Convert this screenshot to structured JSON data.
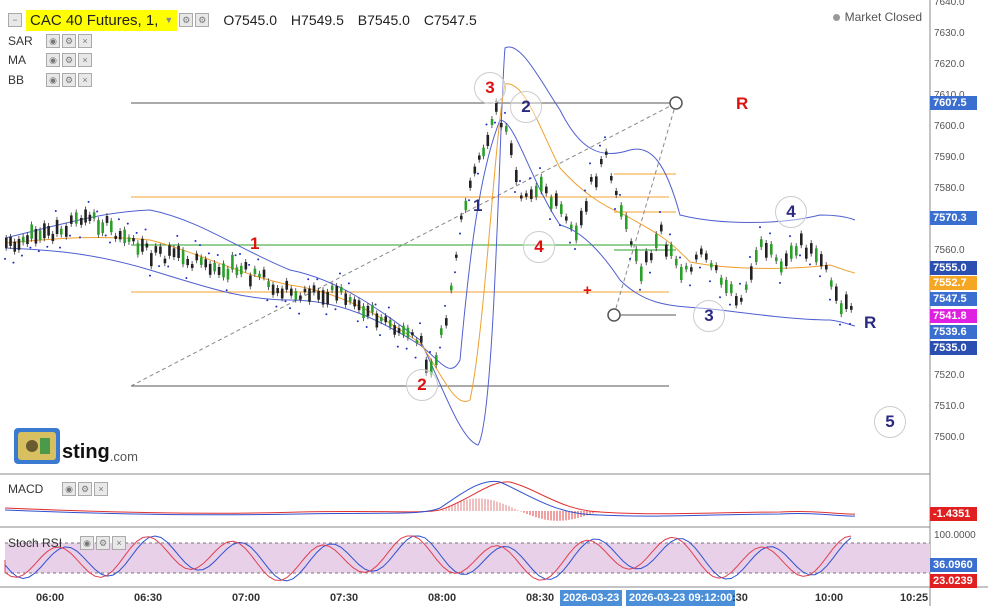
{
  "header": {
    "symbol": "CAC 40 Futures, 1,",
    "ohlc": {
      "open": "O7545.0",
      "high": "H7549.5",
      "low": "B7545.0",
      "close": "C7547.5"
    },
    "market_status": "Market Closed"
  },
  "indicators": [
    "SAR",
    "MA",
    "BB"
  ],
  "price_axis": {
    "ticks": [
      "7640.0",
      "7630.0",
      "7620.0",
      "7610.0",
      "7600.0",
      "7590.0",
      "7580.0",
      "7560.0",
      "7520.0",
      "7510.0",
      "7500.0"
    ],
    "tags": [
      {
        "label": "7607.5",
        "color": "#3a6fd0"
      },
      {
        "label": "7570.3",
        "color": "#3a6fd0"
      },
      {
        "label": "7555.0",
        "color": "#2a4fb0"
      },
      {
        "label": "7552.7",
        "color": "#f5a623"
      },
      {
        "label": "7547.5",
        "color": "#3a6fd0"
      },
      {
        "label": "7541.8",
        "color": "#e020e0"
      },
      {
        "label": "7539.6",
        "color": "#3a6fd0"
      },
      {
        "label": "7535.0",
        "color": "#2a4fb0"
      }
    ]
  },
  "time_axis": {
    "ticks": [
      "06:00",
      "06:30",
      "07:00",
      "07:30",
      "08:00",
      "08:30",
      "10:00",
      "10:25"
    ],
    "highlighted": [
      "2026-03-23",
      "2026-03-23 09:12:00"
    ],
    "partial": ":30"
  },
  "wave_labels": {
    "red": [
      "1",
      "2",
      "3",
      "4",
      "R"
    ],
    "blue": [
      "1",
      "2",
      "3",
      "4",
      "5",
      "R"
    ],
    "trade_marker": "+"
  },
  "macd": {
    "label": "MACD",
    "value": "-1.4351",
    "value_color": "#e02020"
  },
  "stoch": {
    "label": "Stoch RSI",
    "top_level": "100.0000",
    "values": [
      {
        "label": "36.0960",
        "color": "#3a6fd0"
      },
      {
        "label": "23.0239",
        "color": "#e02020"
      }
    ]
  },
  "logo": {
    "name": "sting",
    "domain": ".com"
  }
}
